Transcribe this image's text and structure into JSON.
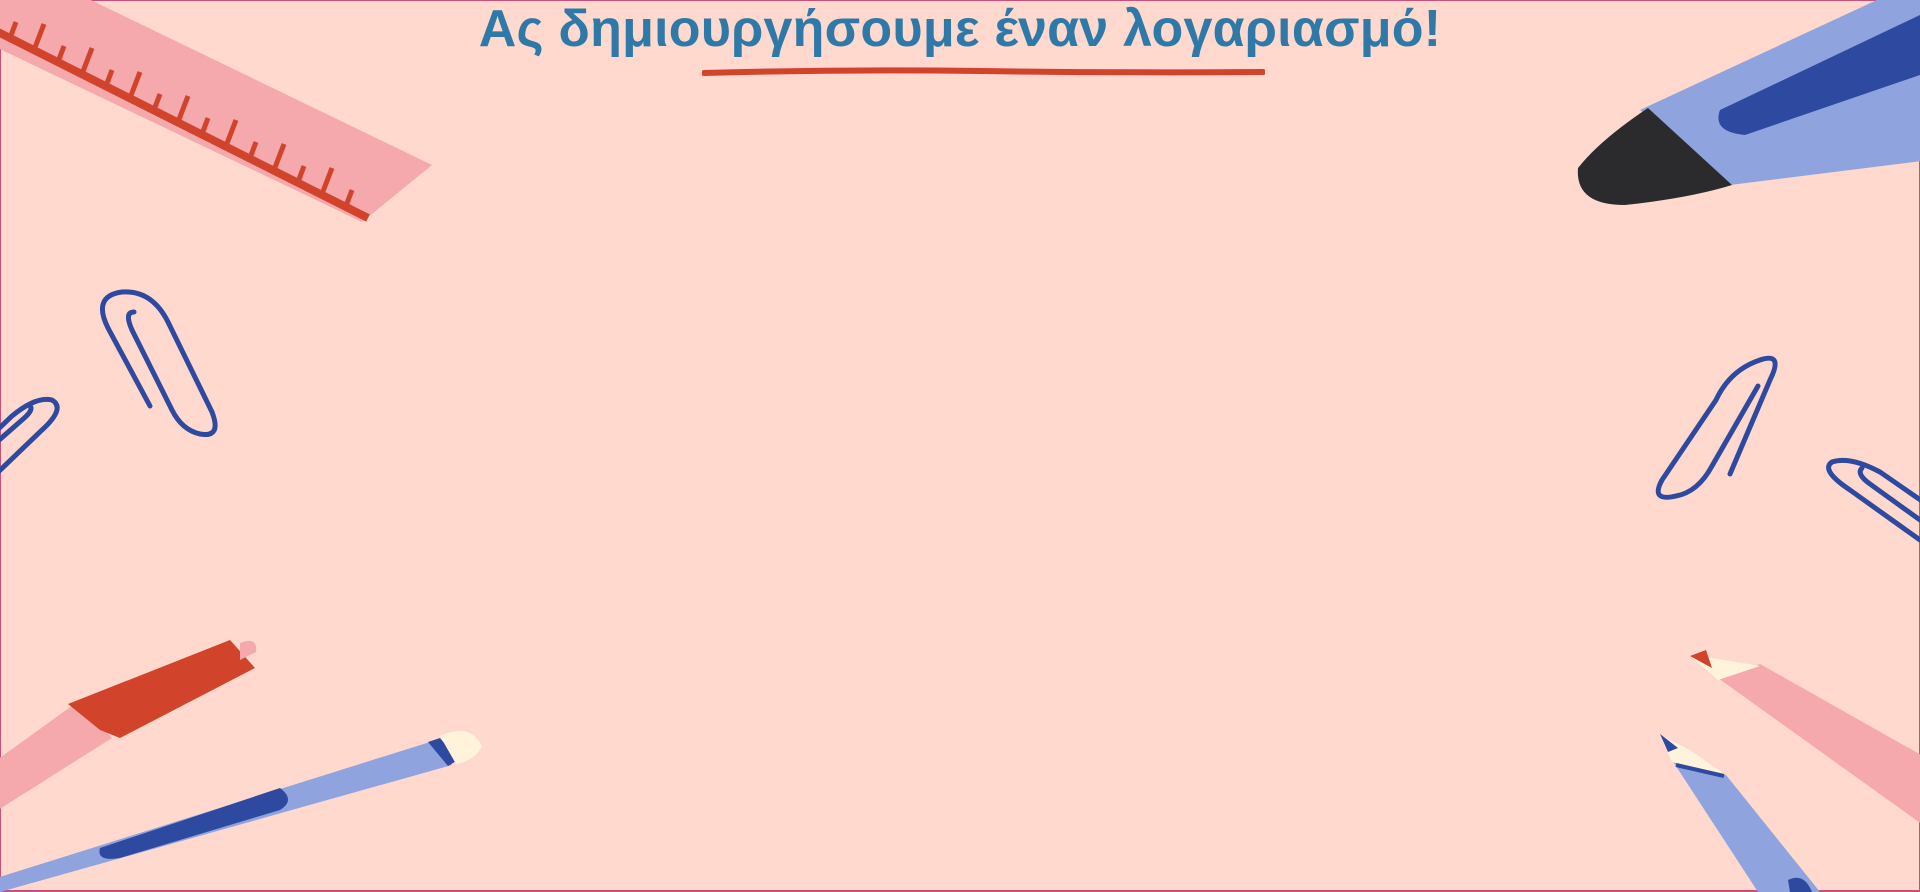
{
  "page": {
    "title": "Ας δημιουργήσουμε έναν λογαριασμό!"
  },
  "decorations": [
    {
      "name": "ruler-icon"
    },
    {
      "name": "marker-icon"
    },
    {
      "name": "paperclip-icon"
    },
    {
      "name": "pen-icon"
    },
    {
      "name": "pencil-icon"
    }
  ],
  "colors": {
    "background": "#ffd9cd",
    "title": "#2f79a8",
    "accent_red": "#d2432c",
    "pink": "#f5a9ad",
    "periwinkle": "#8fa3de",
    "navy": "#2d4aa0",
    "dark": "#2b2b2e",
    "cream": "#fff3dc"
  }
}
